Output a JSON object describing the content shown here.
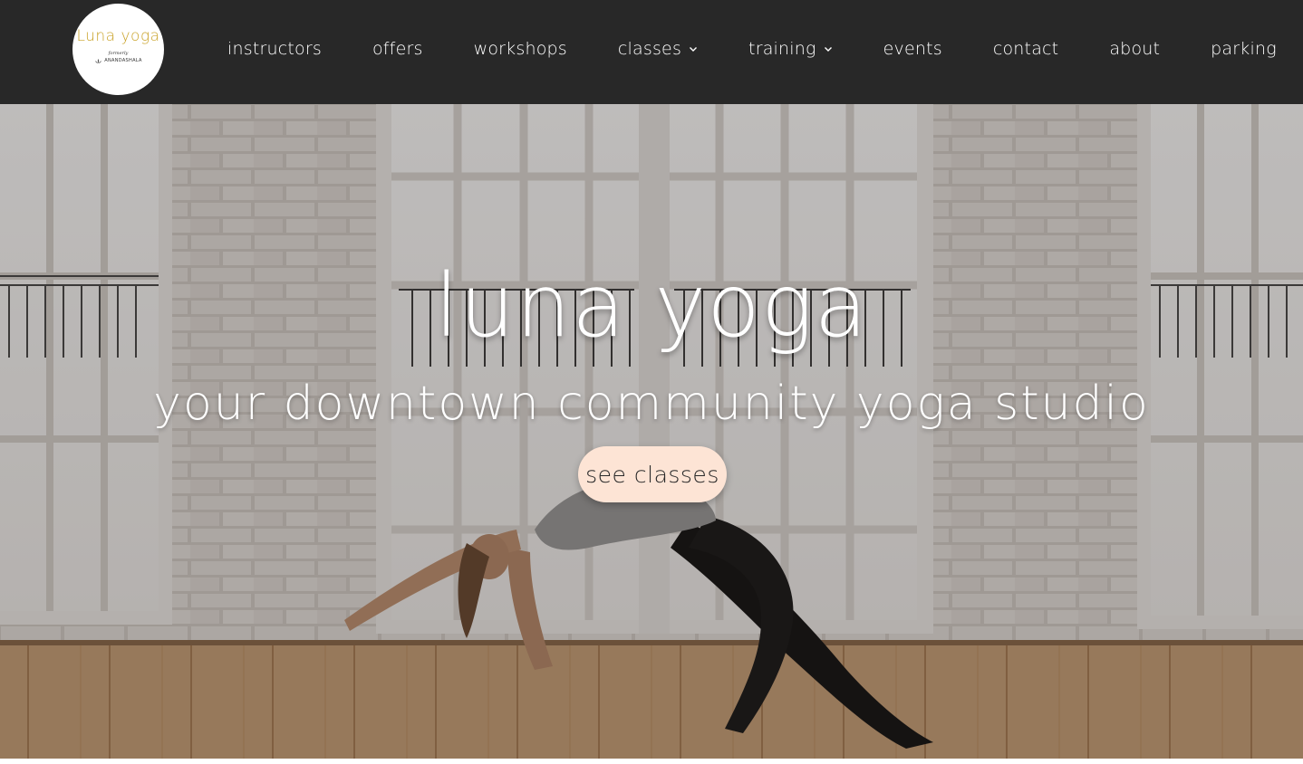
{
  "brand": {
    "logo_text": "Luna yoga",
    "logo_subtext": "formerly",
    "logo_org": "ANANDASHALA"
  },
  "nav": {
    "items": [
      {
        "label": "instructors",
        "has_dropdown": false
      },
      {
        "label": "offers",
        "has_dropdown": false
      },
      {
        "label": "workshops",
        "has_dropdown": false
      },
      {
        "label": "classes",
        "has_dropdown": true
      },
      {
        "label": "training",
        "has_dropdown": true
      },
      {
        "label": "events",
        "has_dropdown": false
      },
      {
        "label": "contact",
        "has_dropdown": false
      },
      {
        "label": "about",
        "has_dropdown": false
      },
      {
        "label": "parking",
        "has_dropdown": false
      }
    ]
  },
  "hero": {
    "title": "luna yoga",
    "subtitle": "your downtown community yoga studio",
    "cta_label": "see classes"
  },
  "colors": {
    "header_bg": "#282828",
    "logo_accent": "#c9a227",
    "cta_bg": "#fde4d5",
    "text_light": "#ffffff"
  }
}
